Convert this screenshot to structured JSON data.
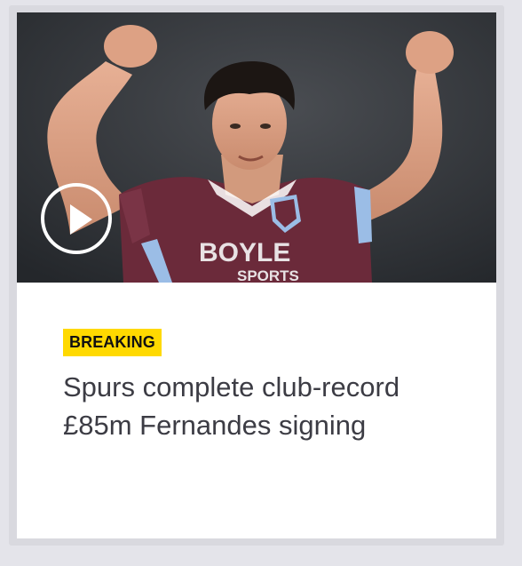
{
  "article": {
    "badge": "BREAKING",
    "headline": "Spurs complete club-record £85m Fernandes signing",
    "shirt_sponsor": "BOYLE",
    "shirt_sponsor_sub": "SPORTS",
    "media_type": "video"
  },
  "icons": {
    "play": "play-icon"
  },
  "colors": {
    "badge_bg": "#ffd900",
    "headline_text": "#3c3c44",
    "card_bg": "#ffffff",
    "page_bg": "#e4e4ea",
    "shirt": "#6b2a3a",
    "shirt_trim": "#9bbde6"
  }
}
